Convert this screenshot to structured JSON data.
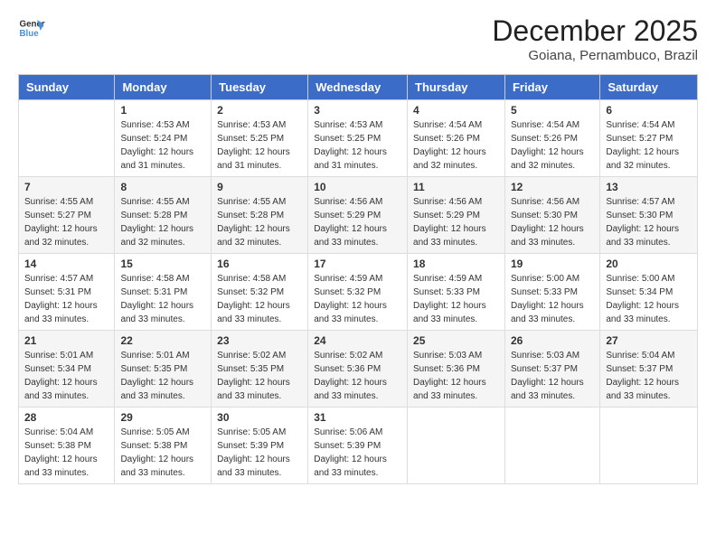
{
  "header": {
    "logo_line1": "General",
    "logo_line2": "Blue",
    "title": "December 2025",
    "location": "Goiana, Pernambuco, Brazil"
  },
  "weekdays": [
    "Sunday",
    "Monday",
    "Tuesday",
    "Wednesday",
    "Thursday",
    "Friday",
    "Saturday"
  ],
  "weeks": [
    [
      {
        "day": "",
        "sunrise": "",
        "sunset": "",
        "daylight": ""
      },
      {
        "day": "1",
        "sunrise": "4:53 AM",
        "sunset": "5:24 PM",
        "daylight": "12 hours and 31 minutes."
      },
      {
        "day": "2",
        "sunrise": "4:53 AM",
        "sunset": "5:25 PM",
        "daylight": "12 hours and 31 minutes."
      },
      {
        "day": "3",
        "sunrise": "4:53 AM",
        "sunset": "5:25 PM",
        "daylight": "12 hours and 31 minutes."
      },
      {
        "day": "4",
        "sunrise": "4:54 AM",
        "sunset": "5:26 PM",
        "daylight": "12 hours and 32 minutes."
      },
      {
        "day": "5",
        "sunrise": "4:54 AM",
        "sunset": "5:26 PM",
        "daylight": "12 hours and 32 minutes."
      },
      {
        "day": "6",
        "sunrise": "4:54 AM",
        "sunset": "5:27 PM",
        "daylight": "12 hours and 32 minutes."
      }
    ],
    [
      {
        "day": "7",
        "sunrise": "4:55 AM",
        "sunset": "5:27 PM",
        "daylight": "12 hours and 32 minutes."
      },
      {
        "day": "8",
        "sunrise": "4:55 AM",
        "sunset": "5:28 PM",
        "daylight": "12 hours and 32 minutes."
      },
      {
        "day": "9",
        "sunrise": "4:55 AM",
        "sunset": "5:28 PM",
        "daylight": "12 hours and 32 minutes."
      },
      {
        "day": "10",
        "sunrise": "4:56 AM",
        "sunset": "5:29 PM",
        "daylight": "12 hours and 33 minutes."
      },
      {
        "day": "11",
        "sunrise": "4:56 AM",
        "sunset": "5:29 PM",
        "daylight": "12 hours and 33 minutes."
      },
      {
        "day": "12",
        "sunrise": "4:56 AM",
        "sunset": "5:30 PM",
        "daylight": "12 hours and 33 minutes."
      },
      {
        "day": "13",
        "sunrise": "4:57 AM",
        "sunset": "5:30 PM",
        "daylight": "12 hours and 33 minutes."
      }
    ],
    [
      {
        "day": "14",
        "sunrise": "4:57 AM",
        "sunset": "5:31 PM",
        "daylight": "12 hours and 33 minutes."
      },
      {
        "day": "15",
        "sunrise": "4:58 AM",
        "sunset": "5:31 PM",
        "daylight": "12 hours and 33 minutes."
      },
      {
        "day": "16",
        "sunrise": "4:58 AM",
        "sunset": "5:32 PM",
        "daylight": "12 hours and 33 minutes."
      },
      {
        "day": "17",
        "sunrise": "4:59 AM",
        "sunset": "5:32 PM",
        "daylight": "12 hours and 33 minutes."
      },
      {
        "day": "18",
        "sunrise": "4:59 AM",
        "sunset": "5:33 PM",
        "daylight": "12 hours and 33 minutes."
      },
      {
        "day": "19",
        "sunrise": "5:00 AM",
        "sunset": "5:33 PM",
        "daylight": "12 hours and 33 minutes."
      },
      {
        "day": "20",
        "sunrise": "5:00 AM",
        "sunset": "5:34 PM",
        "daylight": "12 hours and 33 minutes."
      }
    ],
    [
      {
        "day": "21",
        "sunrise": "5:01 AM",
        "sunset": "5:34 PM",
        "daylight": "12 hours and 33 minutes."
      },
      {
        "day": "22",
        "sunrise": "5:01 AM",
        "sunset": "5:35 PM",
        "daylight": "12 hours and 33 minutes."
      },
      {
        "day": "23",
        "sunrise": "5:02 AM",
        "sunset": "5:35 PM",
        "daylight": "12 hours and 33 minutes."
      },
      {
        "day": "24",
        "sunrise": "5:02 AM",
        "sunset": "5:36 PM",
        "daylight": "12 hours and 33 minutes."
      },
      {
        "day": "25",
        "sunrise": "5:03 AM",
        "sunset": "5:36 PM",
        "daylight": "12 hours and 33 minutes."
      },
      {
        "day": "26",
        "sunrise": "5:03 AM",
        "sunset": "5:37 PM",
        "daylight": "12 hours and 33 minutes."
      },
      {
        "day": "27",
        "sunrise": "5:04 AM",
        "sunset": "5:37 PM",
        "daylight": "12 hours and 33 minutes."
      }
    ],
    [
      {
        "day": "28",
        "sunrise": "5:04 AM",
        "sunset": "5:38 PM",
        "daylight": "12 hours and 33 minutes."
      },
      {
        "day": "29",
        "sunrise": "5:05 AM",
        "sunset": "5:38 PM",
        "daylight": "12 hours and 33 minutes."
      },
      {
        "day": "30",
        "sunrise": "5:05 AM",
        "sunset": "5:39 PM",
        "daylight": "12 hours and 33 minutes."
      },
      {
        "day": "31",
        "sunrise": "5:06 AM",
        "sunset": "5:39 PM",
        "daylight": "12 hours and 33 minutes."
      },
      {
        "day": "",
        "sunrise": "",
        "sunset": "",
        "daylight": ""
      },
      {
        "day": "",
        "sunrise": "",
        "sunset": "",
        "daylight": ""
      },
      {
        "day": "",
        "sunrise": "",
        "sunset": "",
        "daylight": ""
      }
    ]
  ],
  "labels": {
    "sunrise_prefix": "Sunrise: ",
    "sunset_prefix": "Sunset: ",
    "daylight_prefix": "Daylight: "
  }
}
